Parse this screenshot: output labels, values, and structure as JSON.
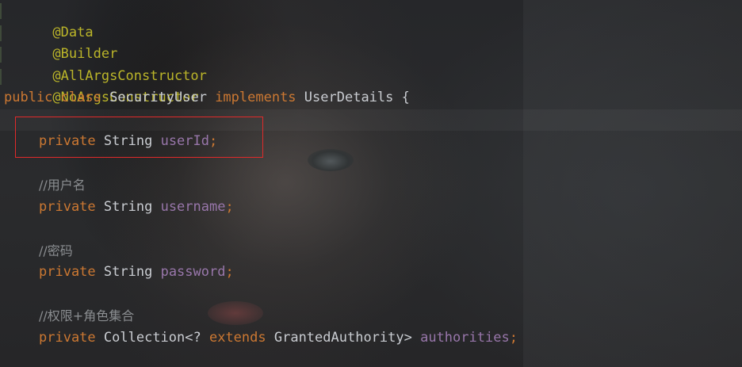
{
  "colors": {
    "annotation": "#bbb529",
    "keyword": "#cc7832",
    "field": "#9876aa",
    "comment": "#8a8d90",
    "text": "#c9ccd1",
    "highlight_box": "#e02a2a"
  },
  "code": {
    "annotations": [
      "@Data",
      "@Builder",
      "@AllArgsConstructor",
      "@NoArgsConstructor"
    ],
    "class_decl": {
      "kw_public": "public",
      "kw_class": "class",
      "name": "SecurityUser",
      "kw_implements": "implements",
      "iface": "UserDetails",
      "brace": "{"
    },
    "fields": [
      {
        "comment": "",
        "modifier": "private",
        "type": "String",
        "name": "userId",
        "semi": ";"
      },
      {
        "comment": "//用户名",
        "modifier": "private",
        "type": "String",
        "name": "username",
        "semi": ";"
      },
      {
        "comment": "//密码",
        "modifier": "private",
        "type": "String",
        "name": "password",
        "semi": ";"
      },
      {
        "comment": "//权限+角色集合",
        "modifier": "private",
        "type_prefix": "Collection<? ",
        "type_kw": "extends",
        "type_suffix": " GrantedAuthority> ",
        "name": "authorities",
        "semi": ";"
      }
    ]
  }
}
